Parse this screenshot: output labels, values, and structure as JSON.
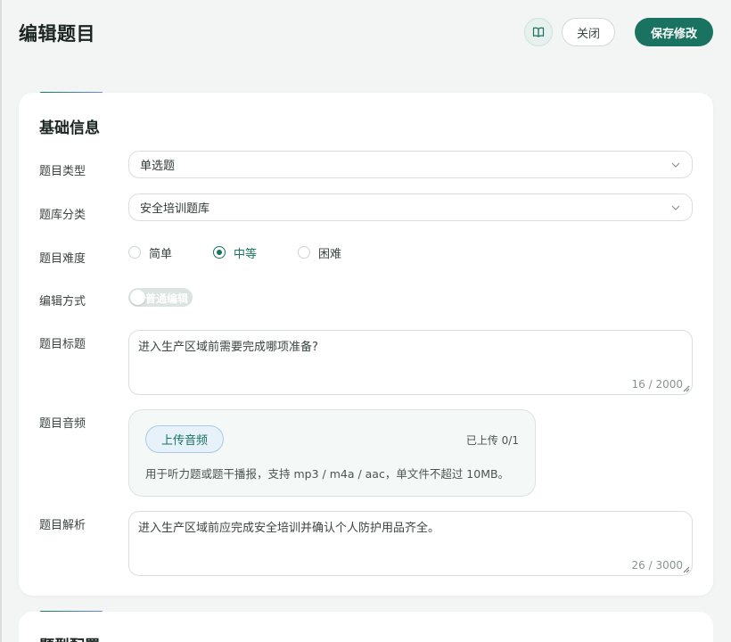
{
  "header": {
    "title": "编辑题目",
    "book_icon": "book-open-icon",
    "close_label": "关闭",
    "save_label": "保存修改"
  },
  "basic": {
    "section_title": "基础信息",
    "type": {
      "label": "题目类型",
      "value": "单选题"
    },
    "bank": {
      "label": "题库分类",
      "value": "安全培训题库"
    },
    "difficulty": {
      "label": "题目难度",
      "options": [
        "简单",
        "中等",
        "困难"
      ],
      "selected": "中等"
    },
    "edit_mode": {
      "label": "编辑方式",
      "toggle_label": "普通编辑"
    },
    "question_title": {
      "label": "题目标题",
      "value": "进入生产区域前需要完成哪项准备?",
      "count": "16 / 2000"
    },
    "audio": {
      "label": "题目音频",
      "upload_label": "上传音频",
      "uploaded": "已上传 0/1",
      "hint": "用于听力题或题干播报，支持 mp3 / m4a / aac，单文件不超过 10MB。"
    },
    "analysis": {
      "label": "题目解析",
      "value": "进入生产区域前应完成安全培训并确认个人防护用品齐全。",
      "count": "26 / 3000"
    }
  },
  "config": {
    "section_title": "题型配置"
  },
  "colors": {
    "accent": "#1a7360",
    "accent_gradient_end": "#6a8fd1"
  }
}
